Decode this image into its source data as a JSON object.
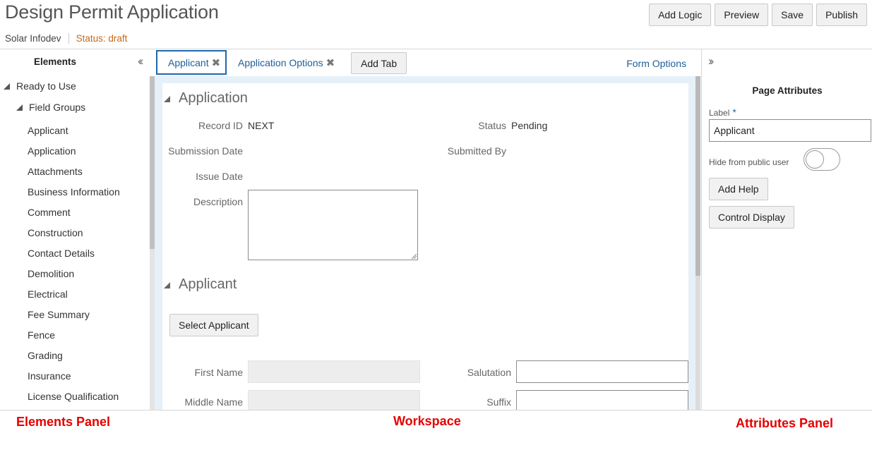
{
  "header": {
    "title": "Design Permit Application",
    "organization": "Solar Infodev",
    "status": "Status: draft",
    "toolbar": [
      "Add Logic",
      "Preview",
      "Save",
      "Publish"
    ]
  },
  "elements_panel": {
    "title": "Elements",
    "collapse_glyph": "‹‹",
    "tree": {
      "root": "Ready to Use",
      "group": "Field Groups",
      "items": [
        "Applicant",
        "Application",
        "Attachments",
        "Business Information",
        "Comment",
        "Construction",
        "Contact Details",
        "Demolition",
        "Electrical",
        "Fee Summary",
        "Fence",
        "Grading",
        "Insurance",
        "License Qualification"
      ]
    }
  },
  "workspace": {
    "tabs": [
      {
        "label": "Applicant",
        "active": true
      },
      {
        "label": "Application Options",
        "active": false
      }
    ],
    "close_glyph": "✖",
    "add_tab": "Add Tab",
    "form_options": "Form Options",
    "sections": {
      "application": {
        "title": "Application",
        "fields": {
          "record_id_label": "Record ID",
          "record_id_value": "NEXT",
          "status_label": "Status",
          "status_value": "Pending",
          "submission_date_label": "Submission Date",
          "submitted_by_label": "Submitted By",
          "issue_date_label": "Issue Date",
          "description_label": "Description"
        }
      },
      "applicant": {
        "title": "Applicant",
        "select_button": "Select Applicant",
        "fields": {
          "first_name_label": "First Name",
          "middle_name_label": "Middle Name",
          "salutation_label": "Salutation",
          "suffix_label": "Suffix"
        }
      }
    }
  },
  "attributes_panel": {
    "expand_glyph": "››",
    "title": "Page Attributes",
    "label_caption": "Label",
    "required_marker": "*",
    "label_value": "Applicant",
    "hide_caption": "Hide from public user",
    "hide_enabled": false,
    "add_help": "Add Help",
    "control_display": "Control Display"
  },
  "annotations": {
    "elements": "Elements Panel",
    "workspace": "Workspace",
    "attributes": "Attributes Panel",
    "color": "#e60000"
  },
  "colors": {
    "accent": "#1f68ad",
    "status_draft": "#c36a1c",
    "canvas_bg": "#e6f0f9"
  }
}
